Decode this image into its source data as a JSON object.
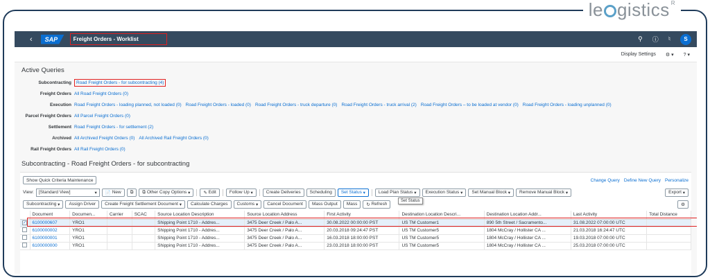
{
  "brand": {
    "logo_text_pre": "le",
    "logo_text_post": "gistics",
    "logo_mark": "R"
  },
  "shell": {
    "back": "‹",
    "sap": "SAP",
    "title": "Freight Orders - Worklist",
    "avatar": "S"
  },
  "subbar": {
    "display_settings": "Display Settings"
  },
  "active_queries": {
    "title": "Active Queries",
    "rows": [
      {
        "label": "Subcontracting",
        "links": [
          "Road Freight Orders - for subcontracting (4)"
        ]
      },
      {
        "label": "Freight Orders",
        "links": [
          "All Road Freight Orders (0)"
        ]
      },
      {
        "label": "Execution",
        "links": [
          "Road Freight Orders - loading planned, not loaded (0)",
          "Road Freight Orders - loaded (0)",
          "Road Freight Orders - truck departure (0)",
          "Road Freight Orders - truck arrival (2)",
          "Road Freight Orders – to be loaded at vendor (0)",
          "Road Freight Orders - loading unplanned (0)"
        ]
      },
      {
        "label": "Parcel Freight Orders",
        "links": [
          "All Parcel Freight Orders (0)"
        ]
      },
      {
        "label": "Settlement",
        "links": [
          "Road Freight Orders - for settlement (2)"
        ]
      },
      {
        "label": "Archived",
        "links": [
          "All Archived Freight Orders (0)",
          "All Archived Rail Freight Orders (0)"
        ]
      },
      {
        "label": "Rail Freight Orders",
        "links": [
          "All Rail Freight Orders (0)"
        ]
      }
    ]
  },
  "worklist": {
    "title": "Subcontracting - Road Freight Orders - for subcontracting",
    "show_quick": "Show Quick Criteria Maintenance",
    "change_query": "Change Query",
    "define_query": "Define New Query",
    "personalize": "Personalize",
    "view_label": "View:",
    "view_value": "[Standard View]",
    "toolbar1": [
      "New",
      "Other Copy Options",
      "Edit",
      "Follow Up",
      "Create Deliveries",
      "Scheduling",
      "Set Status",
      "Load Plan Status",
      "Execution Status",
      "Set Manual Block",
      "Remove Manual Block",
      "Export"
    ],
    "toolbar2": [
      "Subcontracting",
      "Assign Driver",
      "Create Freight Settlement Document",
      "Calculate Charges",
      "Customs",
      "Cancel Document",
      "Mass Output",
      "Mass",
      "Refresh"
    ],
    "tooltip": "Set Status",
    "columns": [
      "Document",
      "Documen...",
      "Carrier",
      "SCAC",
      "Source Location Description",
      "Source Location Address",
      "First Activity",
      "Destination Location Descri...",
      "Destination Location Addr...",
      "Last Activity",
      "Total Distance"
    ],
    "rows": [
      [
        "6100000607",
        "YRO1",
        "",
        "",
        "Shipping Point 1710 - Addres...",
        "3475 Deer Creek / Palo A...",
        "30.08.2022 00:00:00 PST",
        "US TM Customer1",
        "890 5th Street / Sacramento...",
        "31.08.2022 07:00:00 UTC",
        ""
      ],
      [
        "6100000002",
        "YRO1",
        "",
        "",
        "Shipping Point 1710 - Addres...",
        "3475 Deer Creek / Palo A...",
        "20.03.2018 09:24:47 PST",
        "US TM Customer5",
        "1804 McCray / Hollister CA ...",
        "21.03.2018 16:24:47 UTC",
        ""
      ],
      [
        "6100000001",
        "YRO1",
        "",
        "",
        "Shipping Point 1710 - Addres...",
        "3475 Deer Creek / Palo A...",
        "16.03.2018 18:00:00 PST",
        "US TM Customer5",
        "1804 McCray / Hollister CA ...",
        "19.03.2018 07:00:00 UTC",
        ""
      ],
      [
        "6100000000",
        "YRO1",
        "",
        "",
        "Shipping Point 1710 - Addres...",
        "3475 Deer Creek / Palo A...",
        "23.03.2018 18:00:00 PST",
        "US TM Customer5",
        "1804 McCray / Hollister CA ...",
        "25.03.2018 07:00:00 UTC",
        ""
      ]
    ]
  }
}
